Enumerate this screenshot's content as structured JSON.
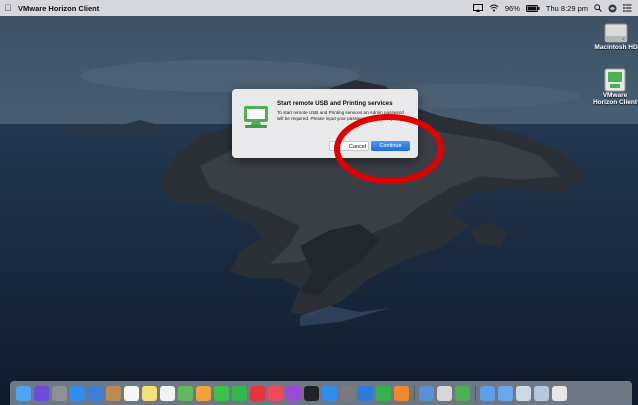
{
  "menubar": {
    "apple_icon": "apple-logo-icon",
    "app_name": "VMware Horizon Client",
    "battery_percent": "96%",
    "clock": "Thu 8:29 pm",
    "status_icons": [
      "screen-mirroring-icon",
      "wifi-icon",
      "battery-icon",
      "spotlight-search-icon",
      "siri-icon",
      "notification-center-icon"
    ]
  },
  "desktop_icons": [
    {
      "label": "Macintosh HD",
      "icon": "hard-drive-icon"
    },
    {
      "label": "VMware Horizon Client",
      "icon": "vmware-horizon-client-icon"
    }
  ],
  "dialog": {
    "title": "Start remote USB and Printing services",
    "message": "To start remote USB and Printing services an Admin password will be required. Please input your password when prompted.",
    "cancel_label": "Cancel",
    "continue_label": "Continue",
    "icon": "vmware-horizon-client-icon"
  },
  "annotation": {
    "shape": "red-circle-highlight",
    "color": "#e00000",
    "target": "continue-button"
  },
  "dock": {
    "items": [
      {
        "name": "finder",
        "color": "#4aa3f0"
      },
      {
        "name": "siri",
        "color": "#6c4bd8"
      },
      {
        "name": "launchpad",
        "color": "#8e8e93"
      },
      {
        "name": "safari",
        "color": "#2e8ff2"
      },
      {
        "name": "mail",
        "color": "#3b7fd6"
      },
      {
        "name": "contacts",
        "color": "#b98b53"
      },
      {
        "name": "calendar",
        "color": "#f6f6f6"
      },
      {
        "name": "notes",
        "color": "#f7e07a"
      },
      {
        "name": "reminders",
        "color": "#f2f2f2"
      },
      {
        "name": "maps",
        "color": "#5fb85a"
      },
      {
        "name": "photos",
        "color": "#f3a23a"
      },
      {
        "name": "messages",
        "color": "#3cc24a"
      },
      {
        "name": "facetime",
        "color": "#35b84a"
      },
      {
        "name": "news",
        "color": "#e8333f"
      },
      {
        "name": "music",
        "color": "#f24a5a"
      },
      {
        "name": "podcasts",
        "color": "#9b4bd8"
      },
      {
        "name": "tv",
        "color": "#222222"
      },
      {
        "name": "app-store",
        "color": "#2f8ef0"
      },
      {
        "name": "system-preferences",
        "color": "#7a7a7f"
      },
      {
        "name": "keynote",
        "color": "#2a7ae0"
      },
      {
        "name": "numbers",
        "color": "#34b34a"
      },
      {
        "name": "pages",
        "color": "#f08a2a"
      }
    ],
    "items_after_separator": [
      {
        "name": "preview",
        "color": "#5a8fd6"
      },
      {
        "name": "script-editor",
        "color": "#d8d8d8"
      },
      {
        "name": "vmware-horizon-client",
        "color": "#49b14f"
      }
    ],
    "stack_items": [
      {
        "name": "downloads-stack",
        "color": "#5a9ee8"
      },
      {
        "name": "documents-stack",
        "color": "#6aa8ee"
      },
      {
        "name": "screenshots-stack",
        "color": "#cfd8e6"
      },
      {
        "name": "recent-stack",
        "color": "#b8c6da"
      },
      {
        "name": "trash",
        "color": "#e6e6e6"
      }
    ]
  }
}
